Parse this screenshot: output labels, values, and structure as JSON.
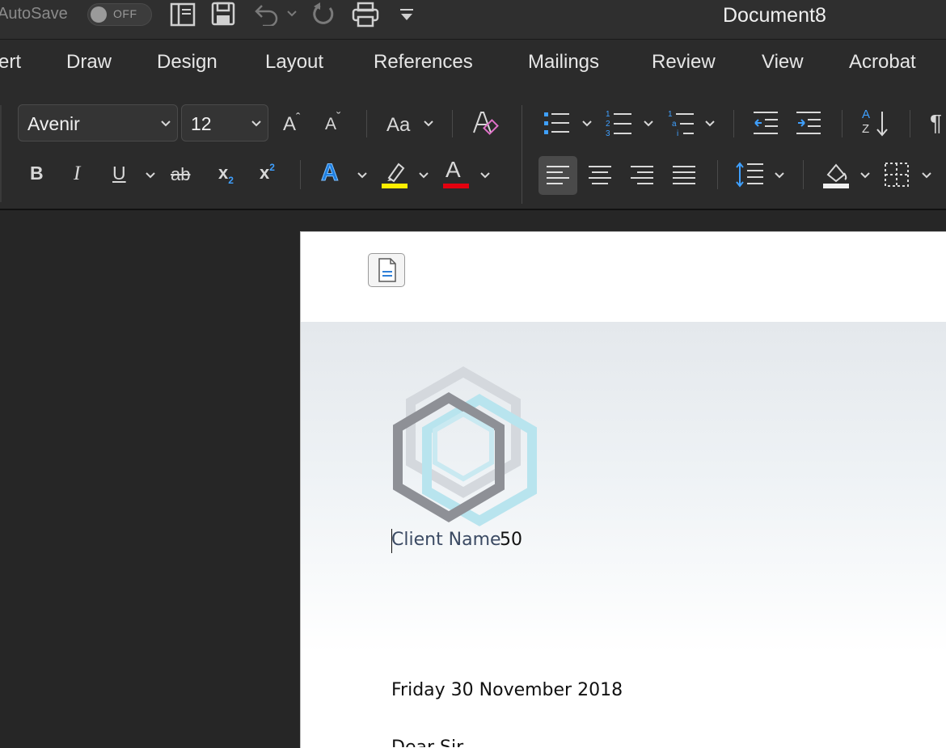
{
  "titlebar": {
    "autosave_label": "AutoSave",
    "autosave_state": "OFF",
    "document_title": "Document8",
    "quick_access": [
      "sidebar-icon",
      "save-icon",
      "undo-icon",
      "redo-icon",
      "print-icon",
      "customize-icon"
    ]
  },
  "ribbon": {
    "tabs": [
      "ert",
      "Draw",
      "Design",
      "Layout",
      "References",
      "Mailings",
      "Review",
      "View",
      "Acrobat"
    ]
  },
  "toolbar": {
    "font_name": "Avenir",
    "font_size": "12",
    "grow_font": "A",
    "shrink_font": "A",
    "change_case": "Aa",
    "bold": "B",
    "italic": "I",
    "underline": "U",
    "strikethrough": "ab",
    "subscript": "x",
    "subscript_sub": "2",
    "superscript": "x",
    "superscript_sup": "2",
    "text_effects": "A",
    "font_color": "A",
    "highlight_color": "#ffee00",
    "font_color_value": "#e3000f",
    "sort_top": "A",
    "sort_bottom": "Z",
    "pilcrow": "¶"
  },
  "document": {
    "client_name_label": "Client Name",
    "client_name_value": " 50",
    "date_line": "Friday 30 November 2018",
    "greeting_partial": "Dear Sir"
  }
}
